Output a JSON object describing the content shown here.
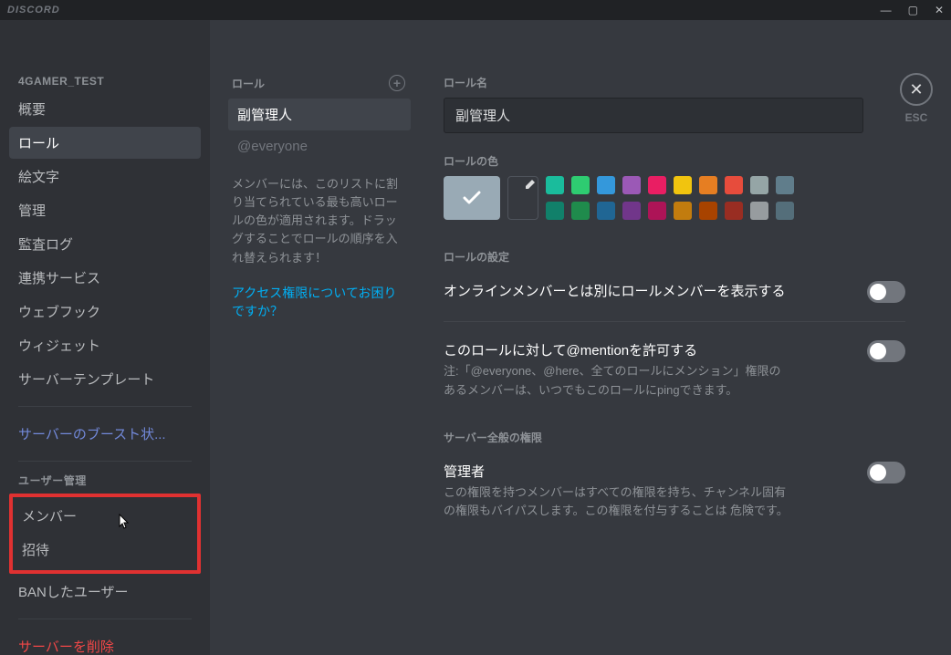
{
  "titlebar": {
    "brand": "DISCORD"
  },
  "sidebar": {
    "server_name": "4GAMER_TEST",
    "items": [
      {
        "label": "概要"
      },
      {
        "label": "ロール",
        "active": true
      },
      {
        "label": "絵文字"
      },
      {
        "label": "管理"
      },
      {
        "label": "監査ログ"
      },
      {
        "label": "連携サービス"
      },
      {
        "label": "ウェブフック"
      },
      {
        "label": "ウィジェット"
      },
      {
        "label": "サーバーテンプレート"
      }
    ],
    "boost": "サーバーのブースト状...",
    "user_mgmt_header": "ユーザー管理",
    "user_mgmt": [
      {
        "label": "メンバー",
        "highlighted": true
      },
      {
        "label": "招待"
      },
      {
        "label": "BANしたユーザー"
      }
    ],
    "delete": "サーバーを削除"
  },
  "roles": {
    "header": "ロール",
    "list": [
      {
        "label": "副管理人",
        "selected": true
      },
      {
        "label": "@everyone"
      }
    ],
    "hint": "メンバーには、このリストに割り当てられている最も高いロールの色が適用されます。ドラッグすることでロールの順序を入れ替えられます！",
    "help_link": "アクセス権限についてお困りですか？"
  },
  "settings": {
    "role_name_label": "ロール名",
    "role_name_value": "副管理人",
    "role_color_label": "ロールの色",
    "color_rows": {
      "top": [
        "#1abc9c",
        "#2ecc71",
        "#3498db",
        "#9b59b6",
        "#e91e63",
        "#f1c40f",
        "#e67e22",
        "#e74c3c",
        "#95a5a6",
        "#607d8b"
      ],
      "bottom": [
        "#11806a",
        "#1f8b4c",
        "#206694",
        "#71368a",
        "#ad1457",
        "#c27c0e",
        "#a84300",
        "#992d22",
        "#979c9f",
        "#546e7a"
      ]
    },
    "role_settings_header": "ロールの設定",
    "display_separate": {
      "title": "オンラインメンバーとは別にロールメンバーを表示する"
    },
    "allow_mention": {
      "title": "このロールに対して@mentionを許可する",
      "note": "注:「@everyone、@here、全てのロールにメンション」権限のあるメンバーは、いつでもこのロールにpingできます。"
    },
    "server_perms_header": "サーバー全般の権限",
    "admin": {
      "title": "管理者",
      "desc": "この権限を持つメンバーはすべての権限を持ち、チャンネル固有の権限もバイパスします。この権限を付与することは 危険です。"
    }
  },
  "esc_label": "ESC"
}
